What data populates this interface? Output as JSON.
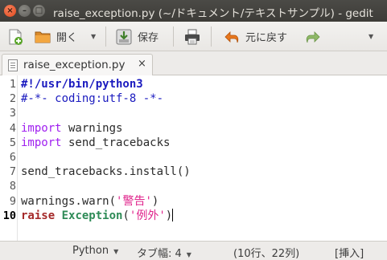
{
  "window": {
    "title": "raise_exception.py (~/ドキュメント/テキストサンプル) - gedit",
    "controls": {
      "close": "×",
      "minimize": "–",
      "maximize": "□"
    }
  },
  "toolbar": {
    "new_icon": "new-document-icon",
    "open_label": "開く",
    "open_icon": "folder-open-icon",
    "save_label": "保存",
    "save_icon": "save-icon",
    "print_icon": "printer-icon",
    "undo_label": "元に戻す",
    "undo_icon": "undo-arrow-icon",
    "redo_icon": "redo-arrow-icon",
    "dropdown_icon": "caret-down-icon"
  },
  "tabs": [
    {
      "label": "raise_exception.py",
      "close": "×"
    }
  ],
  "editor": {
    "current_line": 10,
    "lines": [
      {
        "num": "1",
        "tokens": [
          {
            "t": "#!/usr/bin/python3",
            "c": "shebang"
          }
        ]
      },
      {
        "num": "2",
        "tokens": [
          {
            "t": "#-*- coding:utf-8 -*-",
            "c": "comment"
          }
        ]
      },
      {
        "num": "3",
        "tokens": []
      },
      {
        "num": "4",
        "tokens": [
          {
            "t": "import",
            "c": "kw"
          },
          {
            "t": " warnings",
            "c": "plain"
          }
        ]
      },
      {
        "num": "5",
        "tokens": [
          {
            "t": "import",
            "c": "kw"
          },
          {
            "t": " send_tracebacks",
            "c": "plain"
          }
        ]
      },
      {
        "num": "6",
        "tokens": []
      },
      {
        "num": "7",
        "tokens": [
          {
            "t": "send_tracebacks.install()",
            "c": "plain"
          }
        ]
      },
      {
        "num": "8",
        "tokens": []
      },
      {
        "num": "9",
        "tokens": [
          {
            "t": "warnings.warn(",
            "c": "plain"
          },
          {
            "t": "'警告'",
            "c": "str"
          },
          {
            "t": ")",
            "c": "plain"
          }
        ]
      },
      {
        "num": "10",
        "tokens": [
          {
            "t": "raise",
            "c": "kwb"
          },
          {
            "t": " ",
            "c": "plain"
          },
          {
            "t": "Exception",
            "c": "type"
          },
          {
            "t": "(",
            "c": "plain"
          },
          {
            "t": "'例外'",
            "c": "str"
          },
          {
            "t": ")",
            "c": "plain"
          }
        ]
      }
    ]
  },
  "statusbar": {
    "language": "Python",
    "tab_width": "タブ幅: 4",
    "position": "(10行、22列)",
    "mode": "[挿入]"
  },
  "colors": {
    "keyword": "#a020f0",
    "raise_keyword": "#a52a2a",
    "type": "#2e8b57",
    "string": "#e0248c",
    "comment": "#1a1abf",
    "titlebar": "#3d3c38",
    "close_button": "#e0461a"
  }
}
